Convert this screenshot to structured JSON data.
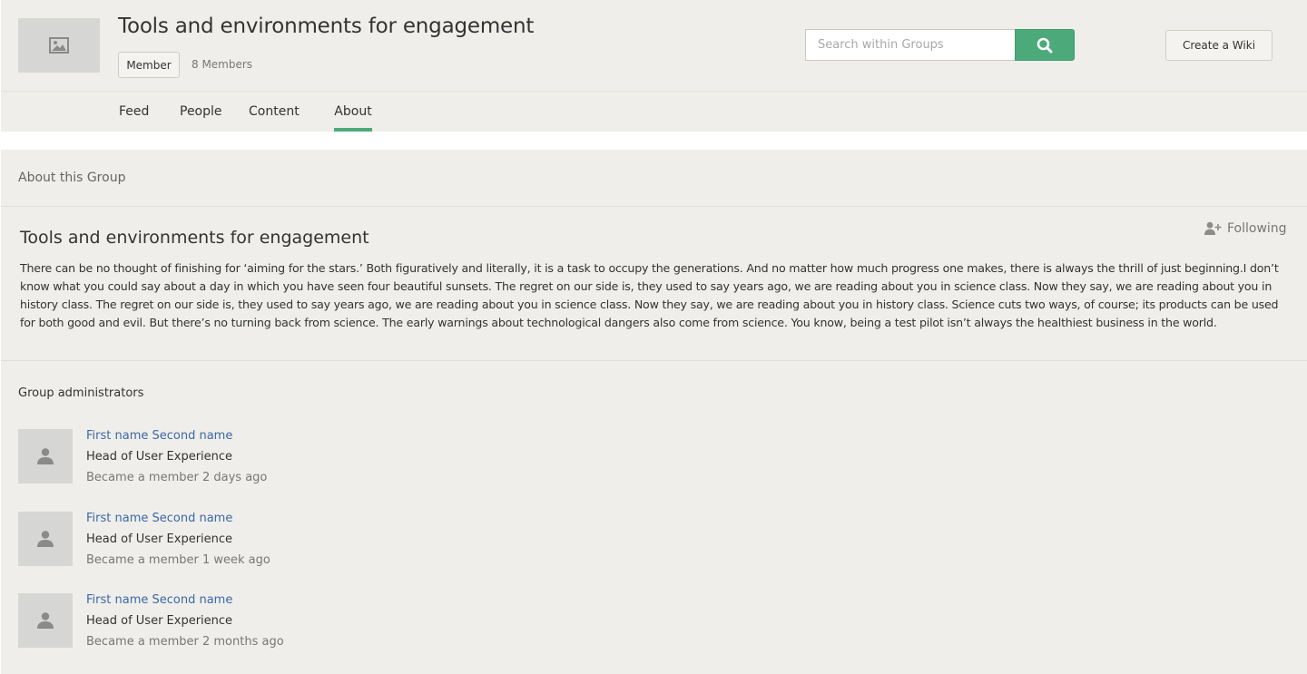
{
  "header": {
    "group_title": "Tools and environments for engagement",
    "member_button_label": "Member",
    "member_count": "8 Members",
    "search_placeholder": "Search within Groups",
    "create_wiki_label": "Create a Wiki",
    "accent_color": "#4caa7a",
    "icons": {
      "thumbnail": "image-placeholder-icon",
      "search": "search-icon"
    }
  },
  "nav": {
    "tabs": [
      {
        "label": "Feed",
        "active": false
      },
      {
        "label": "People",
        "active": false
      },
      {
        "label": "Content",
        "active": false
      },
      {
        "label": "About",
        "active": true
      }
    ]
  },
  "about": {
    "section_heading": "About this Group",
    "title": "Tools and environments for engagement",
    "following_label": "Following",
    "following_icon": "user-follow-icon",
    "description": "There can be no thought of finishing for ‘aiming for the stars.’ Both figuratively and literally, it is a task to occupy the generations. And no matter how much progress one makes, there is always the thrill of just beginning.I don’t know what you could say about a day in which you have seen four beautiful sunsets. The regret on our side is, they used to say years ago, we are reading about you in science class. Now they say, we are reading about you in history class. The regret on our side is, they used to say years ago, we are reading about you in science class. Now they say, we are reading about you in history class. Science cuts two ways, of course; its products can be used for both good and evil. But there’s no turning back from science. The early warnings about technological dangers also come from science. You know, being a test pilot isn’t always the healthiest business in the world."
  },
  "admins": {
    "heading": "Group administrators",
    "avatar_icon": "user-avatar-icon",
    "items": [
      {
        "name": "First name Second name",
        "role": "Head of User Experience",
        "since": "Became a member 2 days ago"
      },
      {
        "name": "First name Second name",
        "role": "Head of User Experience",
        "since": "Became a member 1 week ago"
      },
      {
        "name": "First name Second name",
        "role": "Head of User Experience",
        "since": "Became a member 2 months ago"
      }
    ]
  }
}
